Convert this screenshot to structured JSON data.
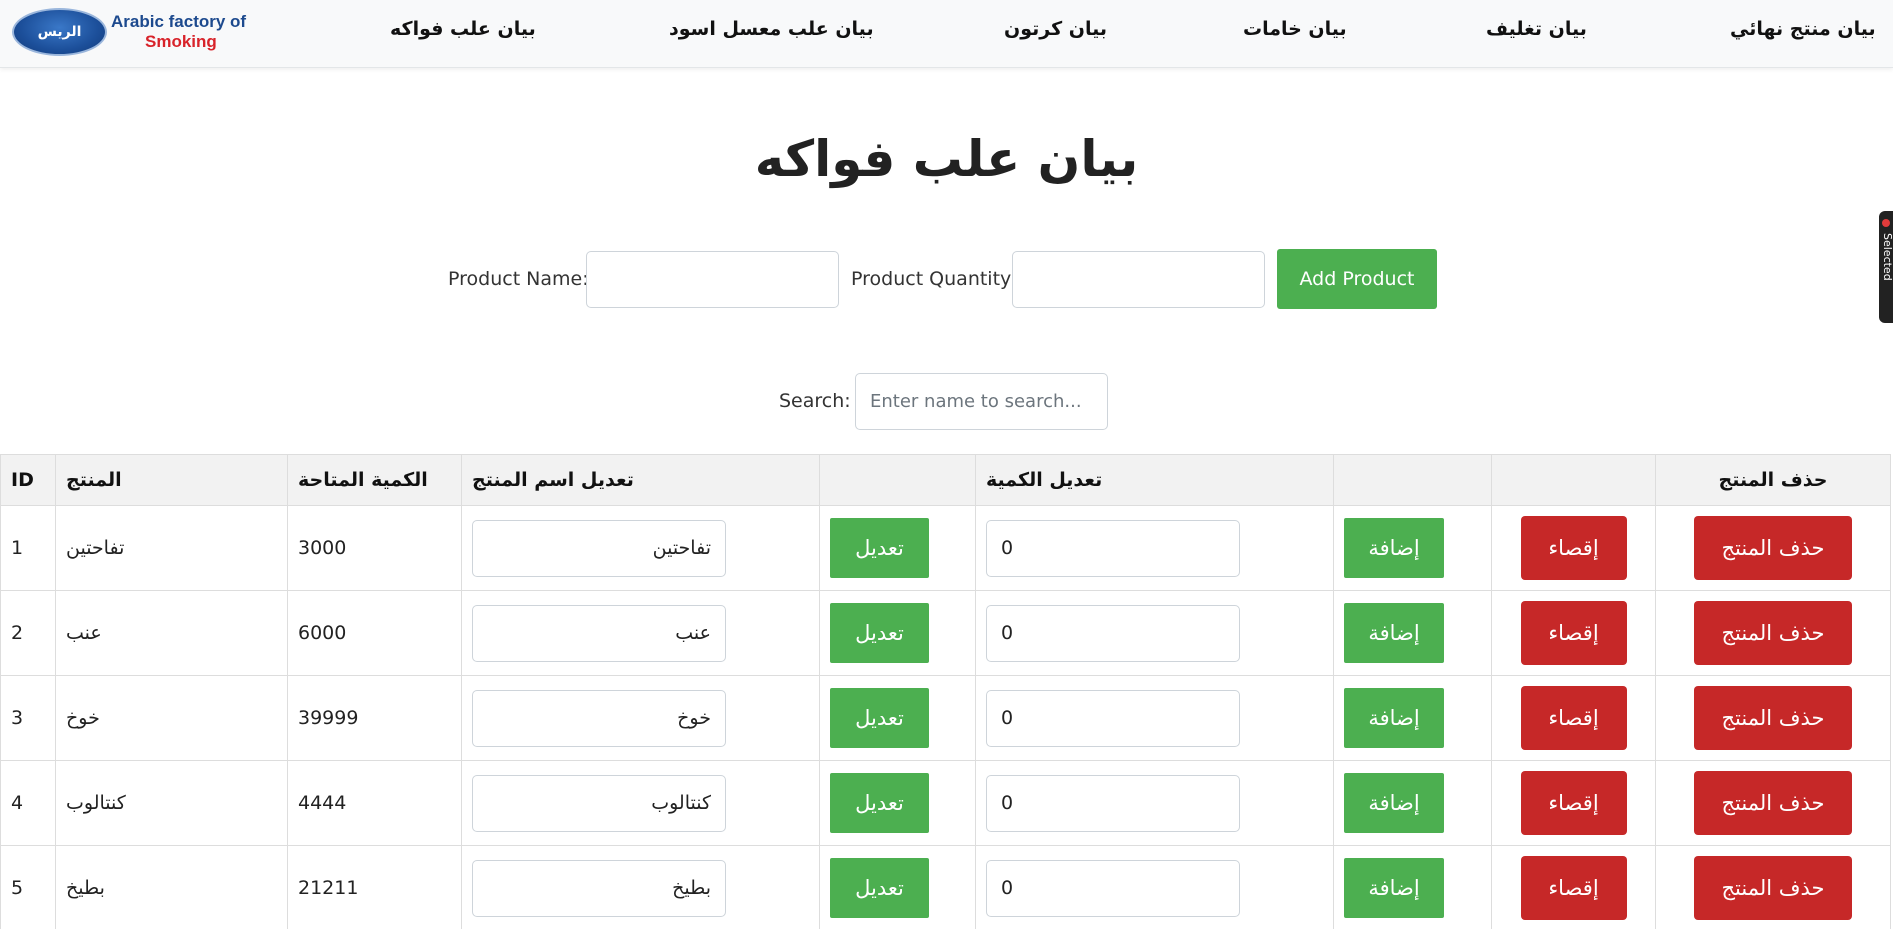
{
  "brand": {
    "emblem_text": "الريس",
    "line1": "Arabic factory of",
    "line2": "Smoking"
  },
  "nav": [
    {
      "label": "بيان علب فواكه"
    },
    {
      "label": "بيان علب معسل اسود"
    },
    {
      "label": "بيان كرتون"
    },
    {
      "label": "بيان خامات"
    },
    {
      "label": "بيان تغليف"
    },
    {
      "label": "بيان منتج نهائي"
    }
  ],
  "side_tab": {
    "label": "Selected"
  },
  "page": {
    "title": "بيان علب فواكه"
  },
  "form": {
    "name_label": "Product Name:",
    "name_value": "",
    "qty_label": "Product Quantity:",
    "qty_value": "",
    "add_label": "Add Product"
  },
  "search": {
    "label": "Search:",
    "placeholder": "Enter name to search..."
  },
  "table": {
    "headers": [
      "ID",
      "المنتج",
      "الكمية المتاحة",
      "تعديل اسم المنتج",
      "",
      "تعديل الكمية",
      "",
      "",
      "حذف المنتج"
    ],
    "edit_label": "تعديل",
    "add_label": "إضافة",
    "deduct_label": "إقصاء",
    "delete_label": "حذف المنتج",
    "rows": [
      {
        "id": "1",
        "name": "تفاحتين",
        "qty": "3000",
        "edit_name": "تفاحتين",
        "edit_qty": "0"
      },
      {
        "id": "2",
        "name": "عنب",
        "qty": "6000",
        "edit_name": "عنب",
        "edit_qty": "0"
      },
      {
        "id": "3",
        "name": "خوخ",
        "qty": "39999",
        "edit_name": "خوخ",
        "edit_qty": "0"
      },
      {
        "id": "4",
        "name": "كنتالوب",
        "qty": "4444",
        "edit_name": "كنتالوب",
        "edit_qty": "0"
      },
      {
        "id": "5",
        "name": "بطيخ",
        "qty": "21211",
        "edit_name": "بطيخ",
        "edit_qty": "0"
      }
    ]
  }
}
